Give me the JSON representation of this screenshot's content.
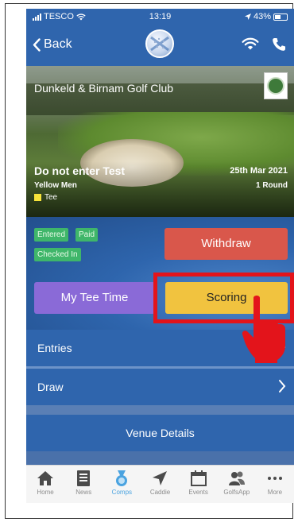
{
  "status_bar": {
    "carrier": "TESCO",
    "time": "13:19",
    "battery": "43%"
  },
  "nav": {
    "back_label": "Back"
  },
  "hero": {
    "club_name": "Dunkeld & Birnam Golf Club",
    "competition": "Do not enter Test",
    "date": "25th Mar 2021",
    "tee": "Yellow Men",
    "rounds": "1 Round",
    "legend_label": "Tee"
  },
  "badges": [
    "Entered",
    "Paid",
    "Checked In"
  ],
  "buttons": {
    "withdraw": "Withdraw",
    "my_tee_time": "My Tee Time",
    "scoring": "Scoring"
  },
  "rows": {
    "entries": "Entries",
    "draw": "Draw",
    "venue": "Venue Details"
  },
  "tabs": [
    {
      "label": "Home",
      "icon": "home-icon"
    },
    {
      "label": "News",
      "icon": "news-icon"
    },
    {
      "label": "Comps",
      "icon": "medal-icon"
    },
    {
      "label": "Caddie",
      "icon": "location-arrow-icon"
    },
    {
      "label": "Events",
      "icon": "calendar-icon"
    },
    {
      "label": "GolfsApp",
      "icon": "people-icon"
    },
    {
      "label": "More",
      "icon": "more-icon"
    }
  ],
  "colors": {
    "primary_blue": "#2f65ad",
    "withdraw_red": "#d9574b",
    "tee_time_purple": "#8a6ad7",
    "scoring_yellow": "#f1c33f",
    "badge_green": "#3fb66a",
    "highlight_red": "#e3141b",
    "tab_active": "#4aa3e0"
  }
}
